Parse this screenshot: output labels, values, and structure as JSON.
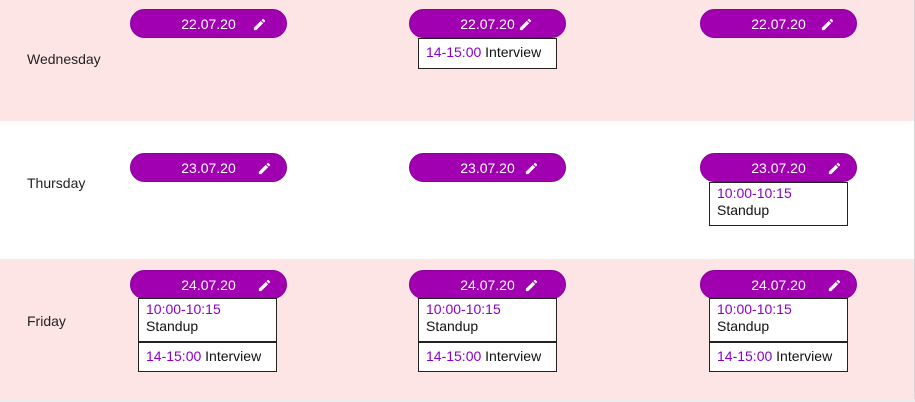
{
  "rows": [
    {
      "day": "Wednesday",
      "cells": [
        {
          "date": "22.07.20",
          "events": []
        },
        {
          "date": "22.07.20",
          "events": [
            {
              "time": "14-15:00",
              "title": "Interview",
              "multiline": false
            }
          ]
        },
        {
          "date": "22.07.20",
          "events": []
        }
      ]
    },
    {
      "day": "Thursday",
      "cells": [
        {
          "date": "23.07.20",
          "events": []
        },
        {
          "date": "23.07.20",
          "events": []
        },
        {
          "date": "23.07.20",
          "events": [
            {
              "time": "10:00-10:15",
              "title": "Standup",
              "multiline": true
            }
          ]
        }
      ]
    },
    {
      "day": "Friday",
      "cells": [
        {
          "date": "24.07.20",
          "events": [
            {
              "time": "10:00-10:15",
              "title": "Standup",
              "multiline": true
            },
            {
              "time": "14-15:00",
              "title": "Interview",
              "multiline": false
            }
          ]
        },
        {
          "date": "24.07.20",
          "events": [
            {
              "time": "10:00-10:15",
              "title": "Standup",
              "multiline": true
            },
            {
              "time": "14-15:00",
              "title": "Interview",
              "multiline": false
            }
          ]
        },
        {
          "date": "24.07.20",
          "events": [
            {
              "time": "10:00-10:15",
              "title": "Standup",
              "multiline": true
            },
            {
              "time": "14-15:00",
              "title": "Interview",
              "multiline": false
            }
          ]
        }
      ]
    }
  ],
  "colors": {
    "accent": "#a000b0",
    "time_text": "#8a00c8",
    "pink_row": "#fde5e5"
  },
  "icons": {
    "edit": "pencil-icon"
  }
}
